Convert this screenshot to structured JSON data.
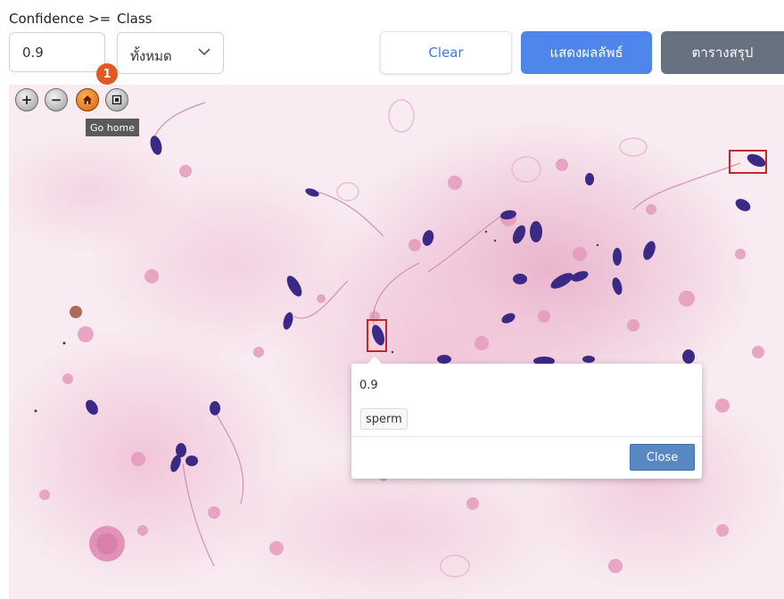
{
  "filters": {
    "confidence_label": "Confidence >=",
    "confidence_value": "0.9",
    "class_label": "Class",
    "class_value": "ทั้งหมด"
  },
  "buttons": {
    "clear": "Clear",
    "show_results": "แสดงผลลัพธ์",
    "summary_table": "ตารางสรุป"
  },
  "viewer": {
    "badge": "1",
    "home_tooltip": "Go home",
    "zoom_in_symbol": "+",
    "zoom_out_symbol": "−",
    "icons": [
      "zoom-in-icon",
      "zoom-out-icon",
      "home-icon",
      "fullscreen-icon"
    ]
  },
  "popup": {
    "score": "0.9",
    "class_tag": "sperm",
    "close_label": "Close"
  },
  "colors": {
    "primary": "#4f86ec",
    "secondary": "#67717f",
    "bbox": "#c0282b",
    "stain_background": "#f7e8ef",
    "sperm_head": "#3a2a86"
  }
}
